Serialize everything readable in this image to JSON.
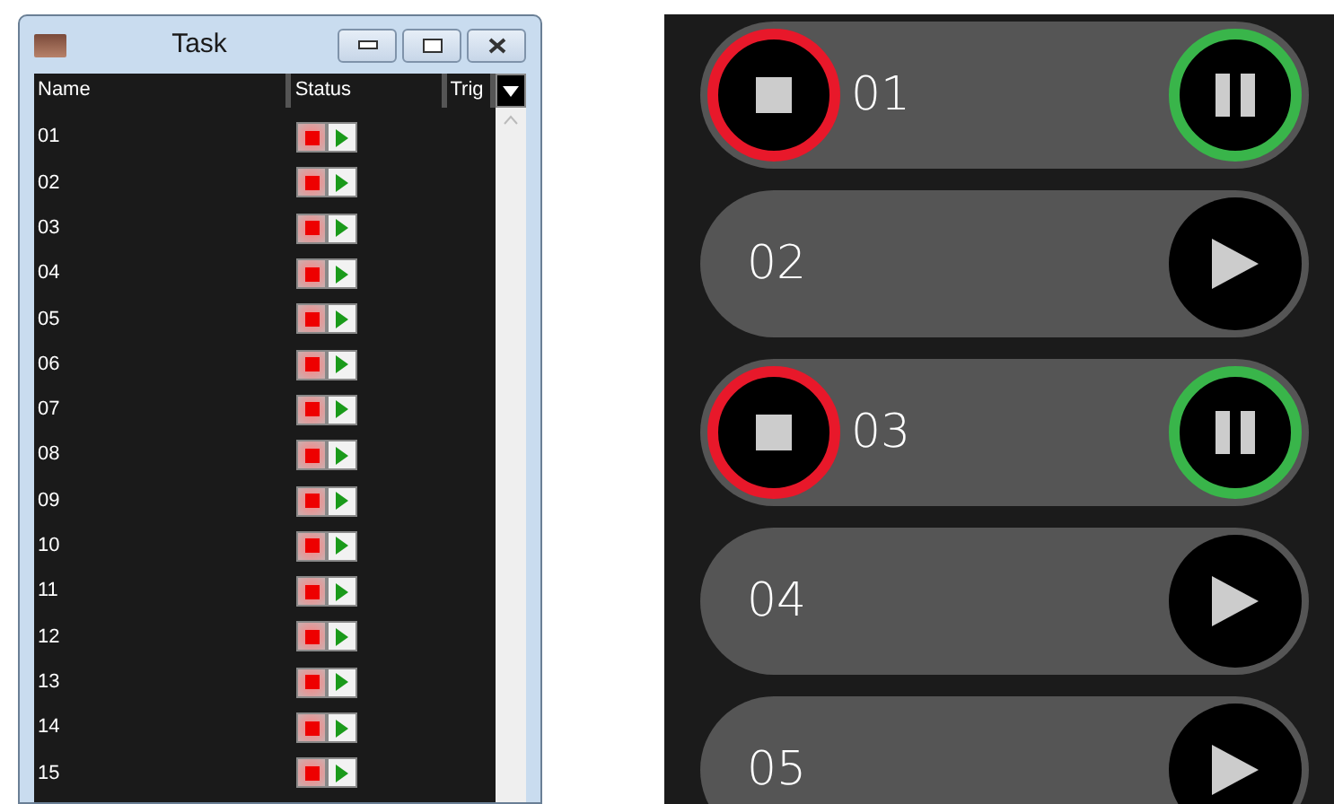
{
  "task_window": {
    "title": "Task",
    "columns": [
      "Name",
      "Status",
      "Trig"
    ],
    "rows": [
      {
        "name": "01"
      },
      {
        "name": "02"
      },
      {
        "name": "03"
      },
      {
        "name": "04"
      },
      {
        "name": "05"
      },
      {
        "name": "06"
      },
      {
        "name": "07"
      },
      {
        "name": "08"
      },
      {
        "name": "09"
      },
      {
        "name": "10"
      },
      {
        "name": "11"
      },
      {
        "name": "12"
      },
      {
        "name": "13"
      },
      {
        "name": "14"
      },
      {
        "name": "15"
      }
    ]
  },
  "task_panel": {
    "items": [
      {
        "name": "01",
        "running": true
      },
      {
        "name": "02",
        "running": false
      },
      {
        "name": "03",
        "running": true
      },
      {
        "name": "04",
        "running": false
      },
      {
        "name": "05",
        "running": false
      }
    ]
  }
}
